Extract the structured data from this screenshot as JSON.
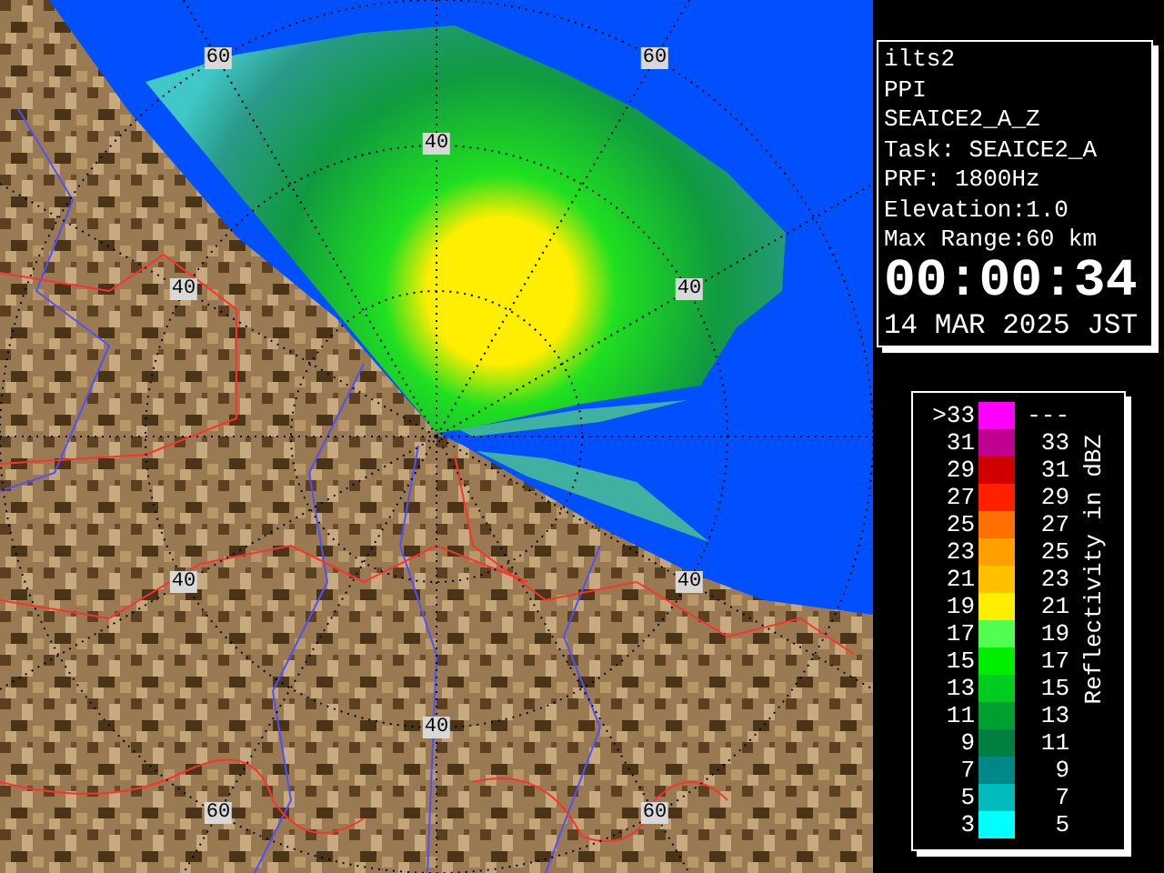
{
  "map": {
    "range_labels": [
      {
        "text": "60"
      },
      {
        "text": "60"
      },
      {
        "text": "40"
      },
      {
        "text": "40"
      },
      {
        "text": "40"
      },
      {
        "text": "40"
      },
      {
        "text": "40"
      },
      {
        "text": "40"
      },
      {
        "text": "60"
      },
      {
        "text": "60"
      }
    ]
  },
  "info": {
    "lines": [
      "ilts2",
      "PPI",
      "SEAICE2_A_Z",
      "Task: SEAICE2_A",
      "PRF: 1800Hz",
      "Elevation:1.0",
      "Max Range:60 km"
    ],
    "time": "00:00:34",
    "date": "14 MAR 2025 JST"
  },
  "legend": {
    "title": "Reflectivity in dBZ",
    "rows": [
      {
        "low": ">33",
        "high": "---",
        "color": "#ff00ff"
      },
      {
        "low": "31",
        "high": "33",
        "color": "#c00090"
      },
      {
        "low": "29",
        "high": "31",
        "color": "#d00000"
      },
      {
        "low": "27",
        "high": "29",
        "color": "#ff2000"
      },
      {
        "low": "25",
        "high": "27",
        "color": "#ff7000"
      },
      {
        "low": "23",
        "high": "25",
        "color": "#ffa000"
      },
      {
        "low": "21",
        "high": "23",
        "color": "#ffc000"
      },
      {
        "low": "19",
        "high": "21",
        "color": "#ffee00"
      },
      {
        "low": "17",
        "high": "19",
        "color": "#50ff50"
      },
      {
        "low": "15",
        "high": "17",
        "color": "#00ee00"
      },
      {
        "low": "13",
        "high": "15",
        "color": "#00cc20"
      },
      {
        "low": "11",
        "high": "13",
        "color": "#00a030"
      },
      {
        "low": "9",
        "high": "11",
        "color": "#008040"
      },
      {
        "low": "7",
        "high": "9",
        "color": "#008888"
      },
      {
        "low": "5",
        "high": "7",
        "color": "#00bbbb"
      },
      {
        "low": "3",
        "high": "5",
        "color": "#00ffff"
      }
    ]
  }
}
